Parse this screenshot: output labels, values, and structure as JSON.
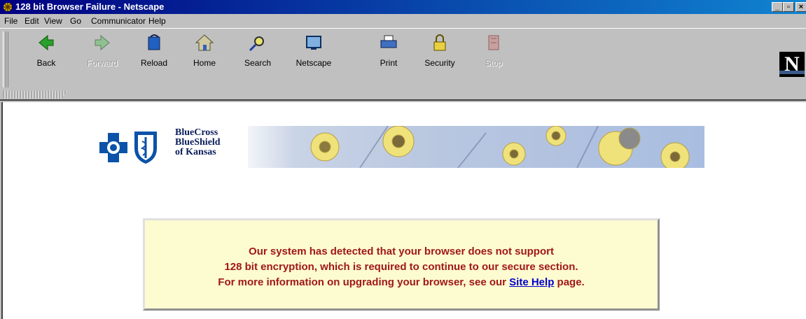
{
  "window": {
    "title": "128 bit Browser Failure - Netscape",
    "controls": [
      "_",
      "▫",
      "×"
    ]
  },
  "menubar": [
    {
      "label": "File"
    },
    {
      "label": "Edit"
    },
    {
      "label": "View"
    },
    {
      "label": "Go"
    },
    {
      "label": "Communicator"
    },
    {
      "label": "Help"
    }
  ],
  "toolbar": {
    "back": "Back",
    "forward": "Forward",
    "reload": "Reload",
    "home": "Home",
    "search": "Search",
    "netscape": "Netscape",
    "print": "Print",
    "security": "Security",
    "stop": "Stop",
    "logo_letter": "N"
  },
  "banner": {
    "brand_line1": "BlueCross",
    "brand_line2": "BlueShield",
    "brand_line3": "of Kansas"
  },
  "message": {
    "line1": "Our system has detected that your browser does not support",
    "line2": "128 bit encryption, which is required to continue to our secure section.",
    "line3_before": "For more information on upgrading your browser, see our ",
    "link": "Site Help",
    "line3_after": " page."
  },
  "colors": {
    "titlebar": "#000080",
    "message_text": "#a01818",
    "message_bg": "#fdfbd0",
    "link": "#0000cc",
    "brand_blue": "#0b52a8"
  }
}
